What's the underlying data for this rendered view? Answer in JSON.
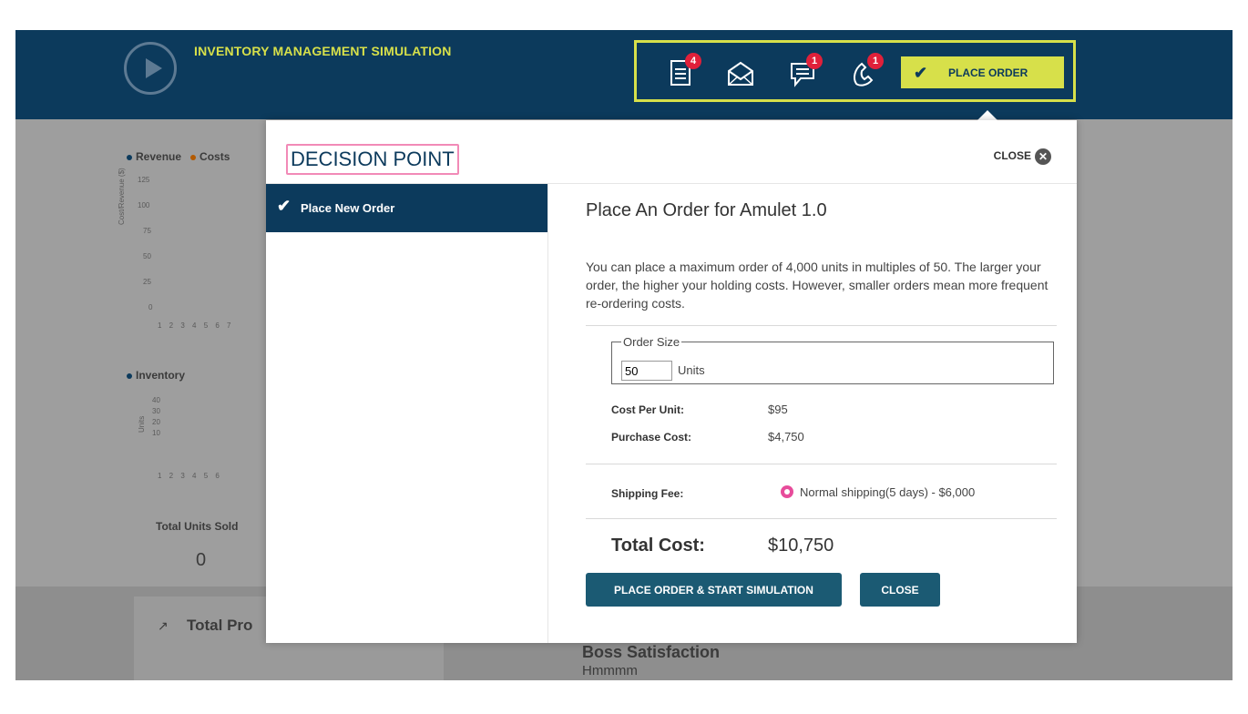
{
  "app": {
    "title": "INVENTORY MANAGEMENT SIMULATION"
  },
  "toolbar": {
    "documents_badge": "4",
    "chat_badge": "1",
    "phone_badge": "1",
    "place_order_label": "PLACE ORDER"
  },
  "dashboard": {
    "chart1": {
      "legend": [
        "Revenue",
        "Costs"
      ],
      "ylabel": "Cost/Revenue ($)",
      "y_ticks": [
        "125",
        "100",
        "75",
        "50",
        "25",
        "0"
      ],
      "x_ticks": "1 2 3 4 5 6 7"
    },
    "chart2": {
      "legend": "Inventory",
      "ylabel": "Units",
      "y_ticks": [
        "40",
        "30",
        "20",
        "10"
      ],
      "x_ticks": "1 2 3 4 5 6"
    },
    "total_units_sold_label": "Total Units Sold",
    "total_units_sold_value": "0",
    "total_profit_label": "Total Pro",
    "boss_label": "Boss Satisfaction",
    "boss_value": "Hmmmm"
  },
  "modal": {
    "title": "DECISION POINT",
    "close_label": "CLOSE",
    "sidebar_item": "Place New Order",
    "heading": "Place An Order for Amulet 1.0",
    "description": "You can place a maximum order of 4,000 units in multiples of 50. The larger your order, the higher your holding costs. However, smaller orders mean more frequent re-ordering costs.",
    "order_size_legend": "Order Size",
    "order_size_value": "50",
    "units_label": "Units",
    "cost_per_unit_label": "Cost Per Unit:",
    "cost_per_unit_value": "$95",
    "purchase_cost_label": "Purchase Cost:",
    "purchase_cost_value": "$4,750",
    "shipping_fee_label": "Shipping Fee:",
    "shipping_option": "Normal shipping(5 days) - $6,000",
    "total_cost_label": "Total Cost:",
    "total_cost_value": "$10,750",
    "place_order_button": "PLACE ORDER & START SIMULATION",
    "close_button": "CLOSE"
  },
  "colors": {
    "navy": "#0c3a5c",
    "accent_yellow": "#d7e04a",
    "teal_button": "#1b5a73",
    "pink": "#e74c9b"
  }
}
